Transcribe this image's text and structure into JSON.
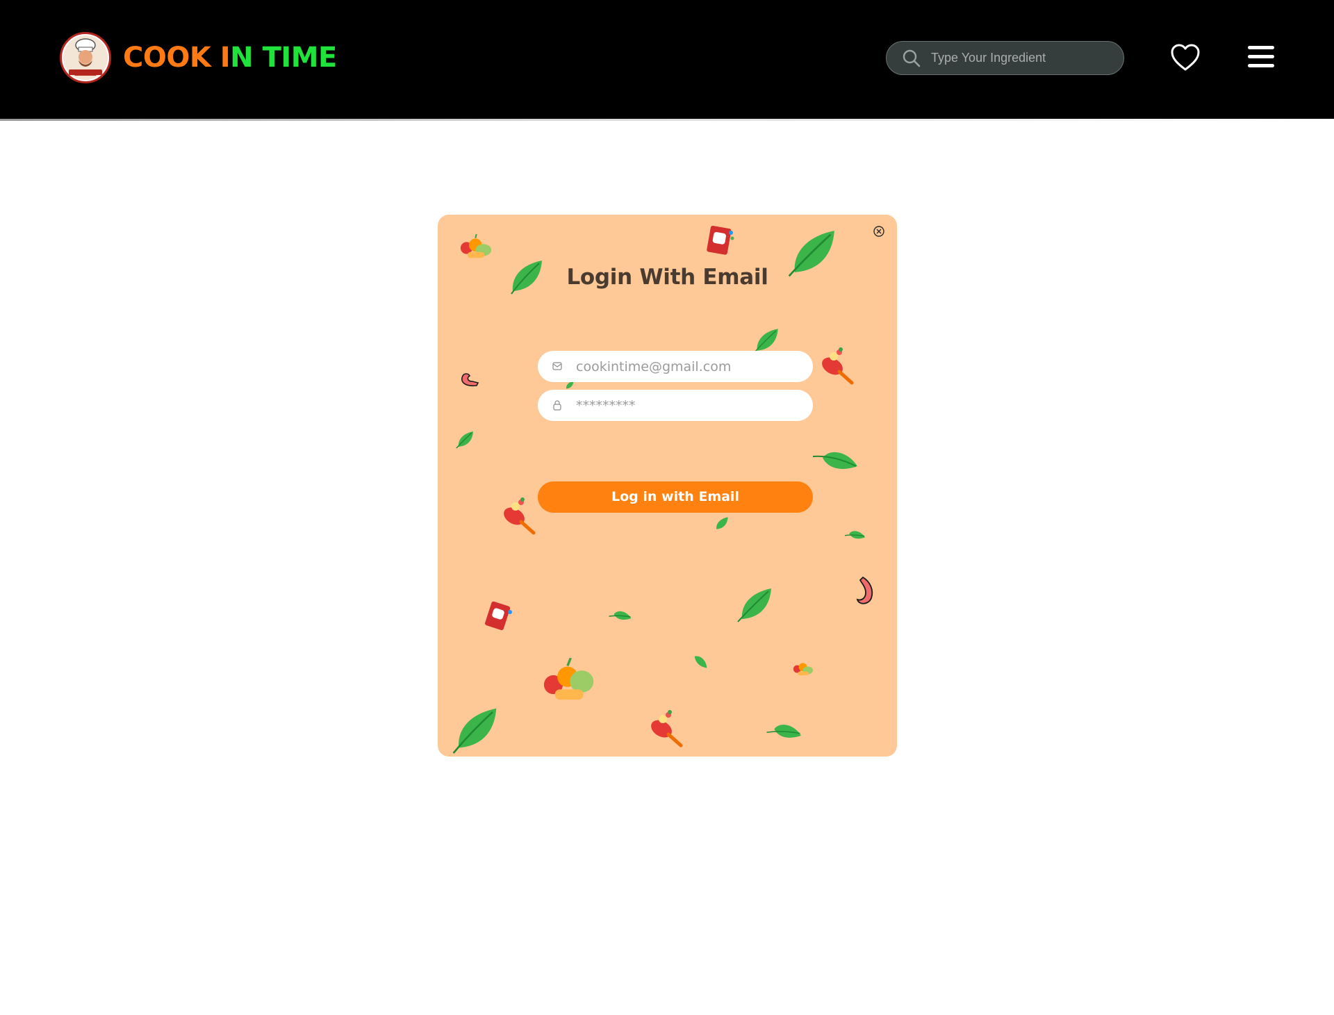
{
  "header": {
    "brand_part1": "COOK I",
    "brand_part2": "N TIME",
    "logo_text": "COOK IN TIME",
    "search_placeholder": "Type Your Ingredient",
    "icons": {
      "logo": "chef-logo-icon",
      "search": "search-icon",
      "favorite": "heart-icon",
      "menu": "hamburger-menu-icon"
    }
  },
  "login_modal": {
    "title": "Login With Email",
    "email_placeholder": "cookintime@gmail.com",
    "password_placeholder": "*********",
    "submit_label": "Log in with Email",
    "icons": {
      "close": "close-circle-icon",
      "email": "mail-icon",
      "password": "lock-icon"
    }
  },
  "colors": {
    "header_bg": "#000000",
    "brand_orange": "#ff7a12",
    "brand_green": "#1fe33b",
    "modal_bg": "#ffc997",
    "button_bg": "#ff8110",
    "title_color": "#4a3b30"
  }
}
